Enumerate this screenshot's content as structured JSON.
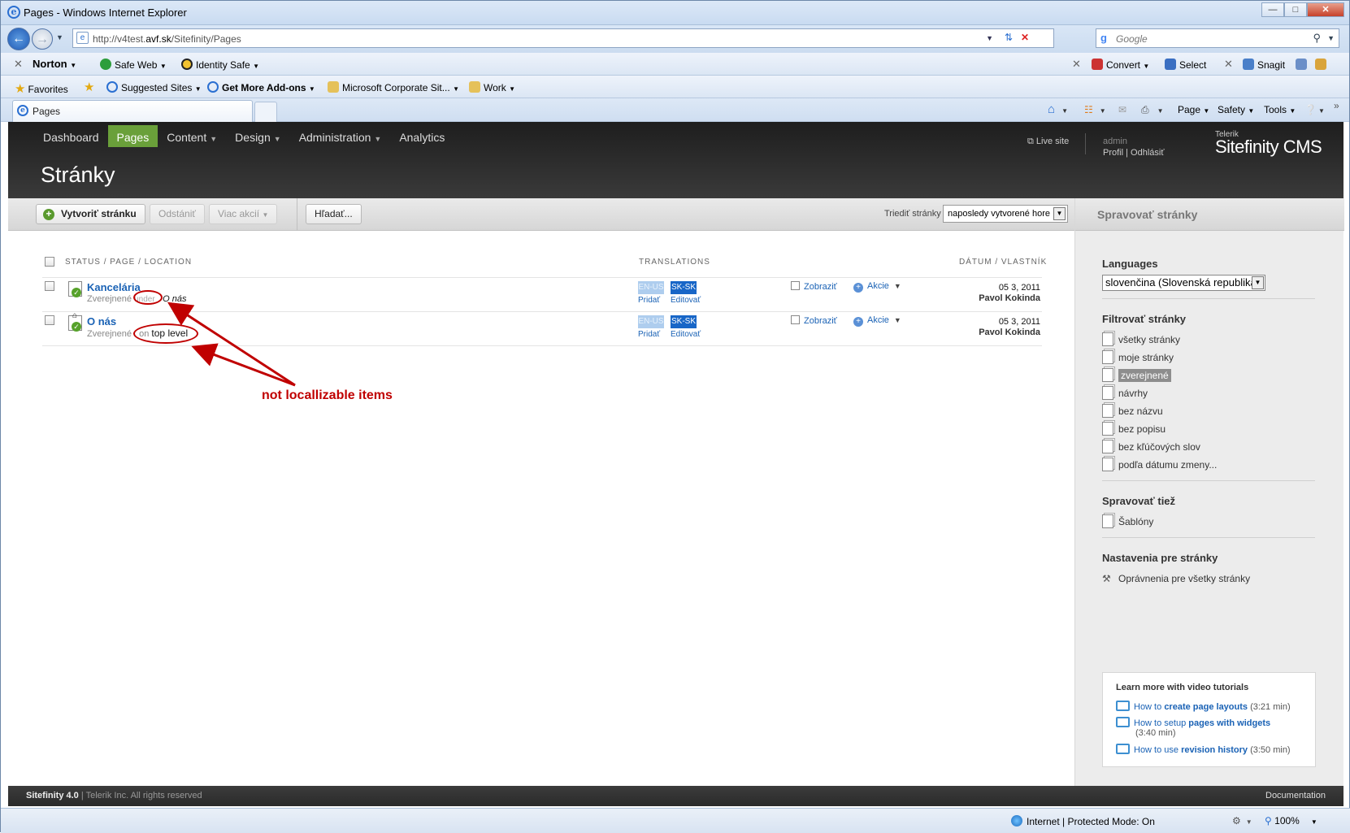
{
  "ie": {
    "window_title": "Pages - Windows Internet Explorer",
    "address_prefix": "http://v4test.",
    "address_domain": "avf.sk",
    "address_path": "/Sitefinity/Pages",
    "search_placeholder": "Google",
    "norton": "Norton",
    "safe_web": "Safe Web",
    "identity_safe": "Identity Safe",
    "convert": "Convert",
    "select": "Select",
    "snagit": "Snagit",
    "favorites": "Favorites",
    "suggested_sites": "Suggested Sites",
    "get_more_addons": "Get More Add-ons",
    "microsoft_corporate": "Microsoft Corporate Sit...",
    "work": "Work",
    "tab_title": "Pages",
    "page_menu": "Page",
    "safety_menu": "Safety",
    "tools_menu": "Tools",
    "status_zone": "Internet | Protected Mode: On",
    "zoom": "100%"
  },
  "sf": {
    "menu": [
      {
        "label": "Dashboard",
        "caret": false,
        "active": false
      },
      {
        "label": "Pages",
        "caret": false,
        "active": true
      },
      {
        "label": "Content",
        "caret": true,
        "active": false
      },
      {
        "label": "Design",
        "caret": true,
        "active": false
      },
      {
        "label": "Administration",
        "caret": true,
        "active": false
      },
      {
        "label": "Analytics",
        "caret": false,
        "active": false
      }
    ],
    "page_title": "Stránky",
    "live_site": "Live site",
    "user_name": "admin",
    "user_profile": "Profil",
    "user_logout": "Odhlásiť",
    "brand_small": "Telerik",
    "brand_name": "Sitefinity CMS",
    "toolbar": {
      "create": "Vytvoriť stránku",
      "delete": "Odstániť",
      "more": "Viac akcií",
      "search": "Hľadať...",
      "sort_label": "Triediť stránky",
      "sort_value": "naposledy vytvorené hore"
    },
    "columns": {
      "status": "STATUS / PAGE / LOCATION",
      "translations": "TRANSLATIONS",
      "date_owner": "DÁTUM / VLASTNÍK"
    },
    "rows": [
      {
        "title": "Kancelária",
        "status": "Zverejnené",
        "rel": "under",
        "location": "O nás",
        "lang_en": "EN-US",
        "lang_sk": "SK-SK",
        "en_action": "Pridať",
        "sk_action": "Editovať",
        "view": "Zobraziť",
        "actions": "Akcie",
        "date": "05 3, 2011",
        "owner": "Pavol Kokinda"
      },
      {
        "title": "O nás",
        "status": "Zverejnené",
        "rel": "on",
        "location": "top level",
        "lang_en": "EN-US",
        "lang_sk": "SK-SK",
        "en_action": "Pridať",
        "sk_action": "Editovať",
        "view": "Zobraziť",
        "actions": "Akcie",
        "date": "05 3, 2011",
        "owner": "Pavol Kokinda"
      }
    ],
    "annotation": "not locallizable items",
    "sidebar": {
      "title": "Spravovať stránky",
      "languages_heading": "Languages",
      "language_value": "slovenčina (Slovenská republika)",
      "filter_heading": "Filtrovať stránky",
      "filters": [
        "všetky stránky",
        "moje stránky",
        "zverejnené",
        "návrhy",
        "bez názvu",
        "bez popisu",
        "bez kľúčových slov",
        "podľa dátumu zmeny..."
      ],
      "manage_heading": "Spravovať tiež",
      "templates": "Šablóny",
      "settings_heading": "Nastavenia pre stránky",
      "permissions": "Oprávnenia pre všetky stránky",
      "tutorials_heading": "Learn more with video tutorials",
      "tut1_pre": "How to",
      "tut1_link": "create page layouts",
      "tut1_time": "(3:21 min)",
      "tut2_pre": "How to setup",
      "tut2_link": "pages with widgets",
      "tut2_time": "(3:40 min)",
      "tut3_pre": "How to use",
      "tut3_link": "revision history",
      "tut3_time": "(3:50 min)"
    },
    "footer_product": "Sitefinity 4.0",
    "footer_company": "Telerik Inc. All rights reserved",
    "footer_docs": "Documentation"
  },
  "colors": {
    "active_menu": "#6aa03a",
    "link_blue": "#1a62b5",
    "annotation_red": "#c00000",
    "lang_sk": "#1866c7"
  }
}
